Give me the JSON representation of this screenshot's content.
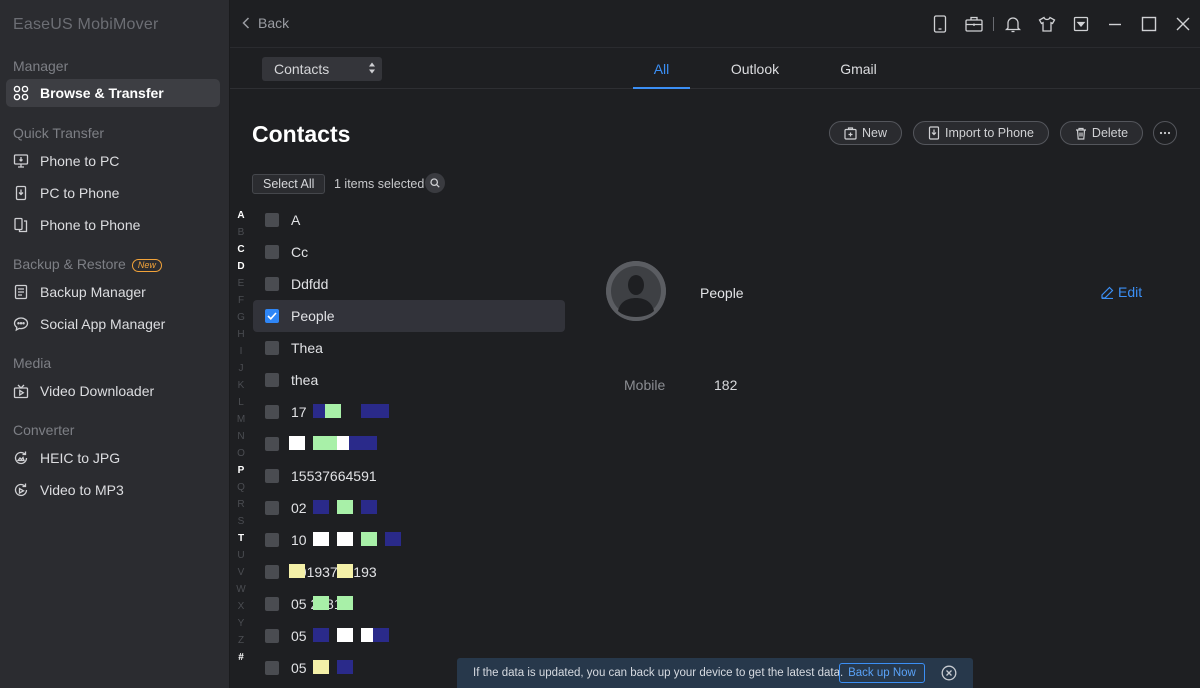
{
  "app": {
    "title": "EaseUS MobiMover"
  },
  "sidebar": {
    "sections": {
      "manager": "Manager",
      "quick_transfer": "Quick Transfer",
      "backup_restore": "Backup & Restore",
      "media": "Media",
      "converter": "Converter"
    },
    "new_badge": "New",
    "items": {
      "browse_transfer": "Browse & Transfer",
      "phone_to_pc": "Phone to PC",
      "pc_to_phone": "PC to Phone",
      "phone_to_phone": "Phone to Phone",
      "backup_manager": "Backup Manager",
      "social_app_manager": "Social App Manager",
      "video_downloader": "Video Downloader",
      "heic_to_jpg": "HEIC to JPG",
      "video_to_mp3": "Video to MP3"
    }
  },
  "topbar": {
    "back_label": "Back"
  },
  "filter": {
    "category_selected": "Contacts",
    "tabs": {
      "all": "All",
      "outlook": "Outlook",
      "gmail": "Gmail"
    },
    "active_tab": "all"
  },
  "main": {
    "title": "Contacts",
    "actions": {
      "new": "New",
      "import": "Import to Phone",
      "delete": "Delete"
    },
    "select_all": "Select All",
    "selected_count": "1 items selected",
    "alphabet": [
      "A",
      "B",
      "C",
      "D",
      "E",
      "F",
      "G",
      "H",
      "I",
      "J",
      "K",
      "L",
      "M",
      "N",
      "O",
      "P",
      "Q",
      "R",
      "S",
      "T",
      "U",
      "V",
      "W",
      "X",
      "Y",
      "Z",
      "#"
    ],
    "alphabet_active": [
      "A",
      "C",
      "D",
      "P",
      "T",
      "#"
    ],
    "contacts": [
      {
        "name": "A",
        "checked": false
      },
      {
        "name": "Cc",
        "checked": false
      },
      {
        "name": "Ddfdd",
        "checked": false
      },
      {
        "name": "People",
        "checked": true
      },
      {
        "name": "Thea",
        "checked": false
      },
      {
        "name": "thea",
        "checked": false
      },
      {
        "name": "17",
        "checked": false
      },
      {
        "name": "",
        "checked": false
      },
      {
        "name": "15537664591",
        "checked": false
      },
      {
        "name": "02",
        "checked": false
      },
      {
        "name": "10",
        "checked": false
      },
      {
        "name": "10193746193",
        "checked": false
      },
      {
        "name": "05      21818",
        "checked": false
      },
      {
        "name": "05",
        "checked": false
      },
      {
        "name": "05",
        "checked": false
      }
    ]
  },
  "details": {
    "name": "People",
    "edit_label": "Edit",
    "mobile_label": "Mobile",
    "mobile_value": "182"
  },
  "toast": {
    "message": "If the data is updated, you can back up your device to get the latest data.",
    "button": "Back up Now"
  },
  "colors": {
    "accent": "#3b8ff5",
    "new_badge": "#f2a33a"
  }
}
